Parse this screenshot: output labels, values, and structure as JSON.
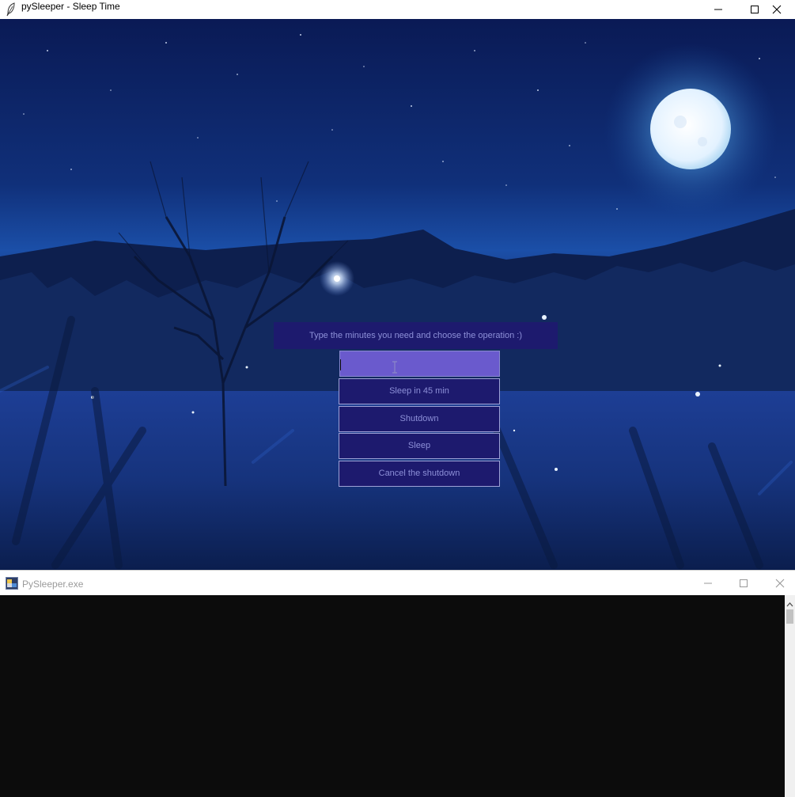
{
  "main_window": {
    "title": "pySleeper - Sleep Time",
    "prompt": "Type the minutes you need and choose the operation :)",
    "minutes_input": {
      "value": "",
      "placeholder": ""
    },
    "buttons": {
      "sleep_in_45": "Sleep in 45 min",
      "shutdown": "Shutdown",
      "sleep": "Sleep",
      "cancel_shutdown": "Cancel the shutdown"
    },
    "background": "night meadow with full moon"
  },
  "console_window": {
    "title": "PySleeper.exe"
  },
  "colors": {
    "widget_bg": "#1d1a6e",
    "widget_text": "#8d90d8",
    "entry_bg": "#6a5acd",
    "console_bg": "#0c0c0c"
  },
  "icons": [
    "feather-icon",
    "minimize-icon",
    "maximize-icon",
    "close-icon",
    "console-app-icon",
    "scroll-up-icon",
    "text-cursor-icon"
  ]
}
